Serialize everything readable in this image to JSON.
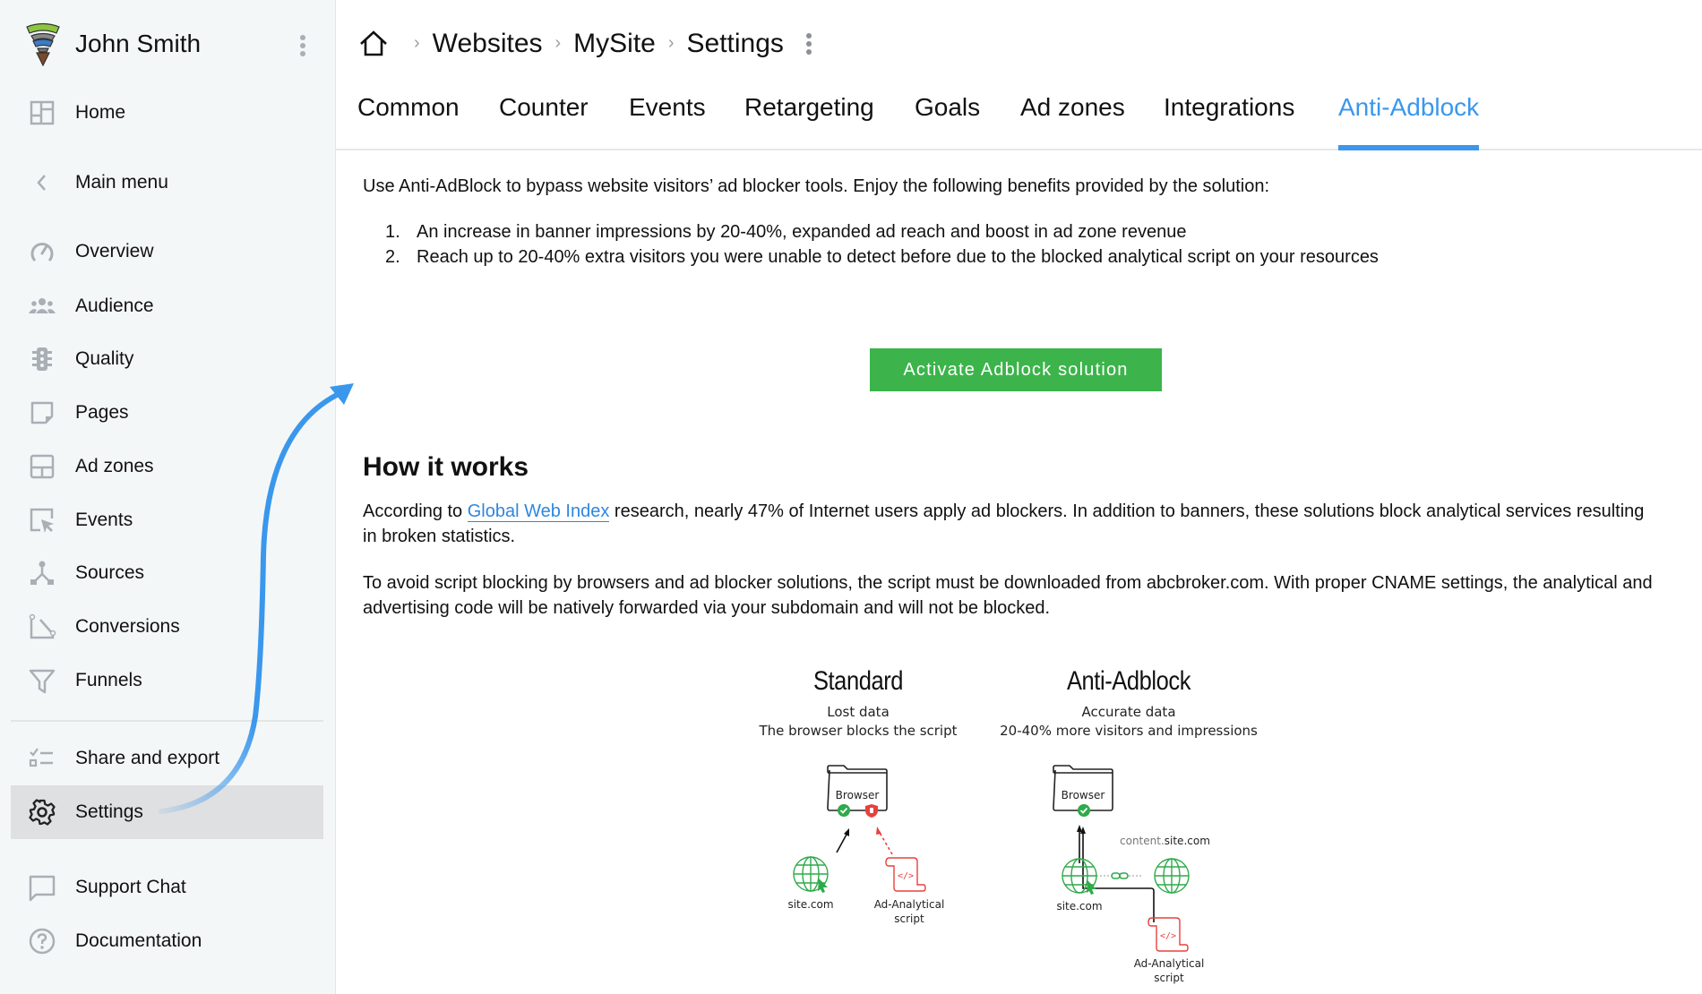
{
  "sidebar": {
    "user_name": "John Smith",
    "items": [
      {
        "id": "home",
        "label": "Home",
        "icon": "dashboard-icon"
      },
      {
        "id": "main-menu",
        "label": "Main menu",
        "icon": "chevron-left-icon"
      },
      {
        "id": "overview",
        "label": "Overview",
        "icon": "speedometer-icon"
      },
      {
        "id": "audience",
        "label": "Audience",
        "icon": "people-icon"
      },
      {
        "id": "quality",
        "label": "Quality",
        "icon": "traffic-light-icon"
      },
      {
        "id": "pages",
        "label": "Pages",
        "icon": "note-icon"
      },
      {
        "id": "ad-zones",
        "label": "Ad zones",
        "icon": "layout-icon"
      },
      {
        "id": "events",
        "label": "Events",
        "icon": "cursor-select-icon"
      },
      {
        "id": "sources",
        "label": "Sources",
        "icon": "branch-icon"
      },
      {
        "id": "conversions",
        "label": "Conversions",
        "icon": "conversion-icon"
      },
      {
        "id": "funnels",
        "label": "Funnels",
        "icon": "funnel-icon"
      },
      {
        "id": "share-and-export",
        "label": "Share and export",
        "icon": "checklist-icon"
      },
      {
        "id": "settings",
        "label": "Settings",
        "icon": "gear-icon",
        "active": true
      },
      {
        "id": "support-chat",
        "label": "Support Chat",
        "icon": "chat-icon"
      },
      {
        "id": "documentation",
        "label": "Documentation",
        "icon": "help-circle-icon"
      }
    ]
  },
  "breadcrumb": {
    "items": [
      "Websites",
      "MySite",
      "Settings"
    ],
    "separator": "›"
  },
  "tabs": [
    {
      "label": "Common"
    },
    {
      "label": "Counter"
    },
    {
      "label": "Events"
    },
    {
      "label": "Retargeting"
    },
    {
      "label": "Goals"
    },
    {
      "label": "Ad zones"
    },
    {
      "label": "Integrations"
    },
    {
      "label": "Anti-Adblock",
      "active": true
    }
  ],
  "main": {
    "intro": "Use Anti-AdBlock to bypass website visitors’ ad blocker tools. Enjoy the following benefits provided by the solution:",
    "benefits": [
      {
        "num": "1.",
        "text": "An increase in banner impressions by 20-40%, expanded ad reach and boost in ad zone revenue"
      },
      {
        "num": "2.",
        "text": "Reach up to 20-40% extra visitors you were unable to detect before due to the blocked analytical script on your resources"
      }
    ],
    "activate_button": "Activate Adblock solution",
    "how_title": "How it works",
    "para1_before": "According to ",
    "para1_link": "Global Web Index",
    "para1_after": " research, nearly 47% of Internet users apply ad blockers. In addition to banners, these solutions block analytical services resulting in broken statistics.",
    "para2": "To avoid script blocking by browsers and ad blocker solutions, the script must be downloaded from abcbroker.com. With proper CNAME settings, the analytical and advertising code will be natively forwarded via your subdomain and will not be blocked."
  },
  "diagram": {
    "standard": {
      "title": "Standard",
      "subtitle1": "Lost data",
      "subtitle2": "The browser blocks the script",
      "browser_label": "Browser",
      "site_label": "site.com",
      "script_label1": "Ad-Analytical",
      "script_label2": "script"
    },
    "anti": {
      "title": "Anti-Adblock",
      "subtitle1": "Accurate data",
      "subtitle2": "20-40% more visitors and impressions",
      "browser_label": "Browser",
      "site_label": "site.com",
      "content_prefix": "content.",
      "content_domain": "site.com",
      "script_label1": "Ad-Analytical",
      "script_label2": "script"
    }
  },
  "colors": {
    "accent": "#3a97ec",
    "button": "#3cb44b",
    "success": "#2eaa4a",
    "blocked": "#e8403c",
    "icon_gray": "#a9afb5"
  }
}
